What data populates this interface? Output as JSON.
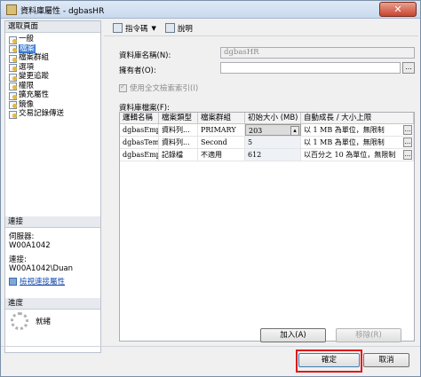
{
  "window": {
    "title": "資料庫屬性 - dgbasHR",
    "close_glyph": "✕"
  },
  "left": {
    "select_page_header": "選取頁面",
    "pages": [
      {
        "label": "一般",
        "selected": false
      },
      {
        "label": "檔案",
        "selected": true
      },
      {
        "label": "檔案群組",
        "selected": false
      },
      {
        "label": "選項",
        "selected": false
      },
      {
        "label": "變更追蹤",
        "selected": false
      },
      {
        "label": "權限",
        "selected": false
      },
      {
        "label": "擴充屬性",
        "selected": false
      },
      {
        "label": "鏡像",
        "selected": false
      },
      {
        "label": "交易記錄傳送",
        "selected": false
      }
    ],
    "connection_header": "連接",
    "server_label": "伺服器:",
    "server_value": "W00A1042",
    "connection_label": "連接:",
    "connection_value": "W00A1042\\Duan",
    "view_connection_link": "檢視連接屬性",
    "progress_header": "進度",
    "progress_status": "就緒"
  },
  "toolbar": {
    "script_label": "指令碼",
    "help_label": "說明"
  },
  "form": {
    "db_name_label": "資料庫名稱(N):",
    "db_name_value": "dgbasHR",
    "owner_label": "擁有者(O):",
    "owner_value": "",
    "fulltext_label": "使用全文檢索索引(I)",
    "files_label": "資料庫檔案(F):"
  },
  "grid": {
    "headers": [
      "邏輯名稱",
      "檔案類型",
      "檔案群組",
      "初始大小 (MB)",
      "自動成長 / 大小上限"
    ],
    "rows": [
      [
        "dgbasEmpty",
        "資料列...",
        "PRIMARY",
        "203",
        "以 1 MB 為單位，無限制"
      ],
      [
        "dgbasTemp",
        "資料列...",
        "Second",
        "5",
        "以 1 MB 為單位，無限制"
      ],
      [
        "dgbasEmpty...",
        "記錄檔",
        "不適用",
        "612",
        "以百分之 10 為單位，無限制"
      ]
    ]
  },
  "buttons": {
    "add": "加入(A)",
    "remove": "移除(R)",
    "ok": "確定",
    "cancel": "取消"
  }
}
